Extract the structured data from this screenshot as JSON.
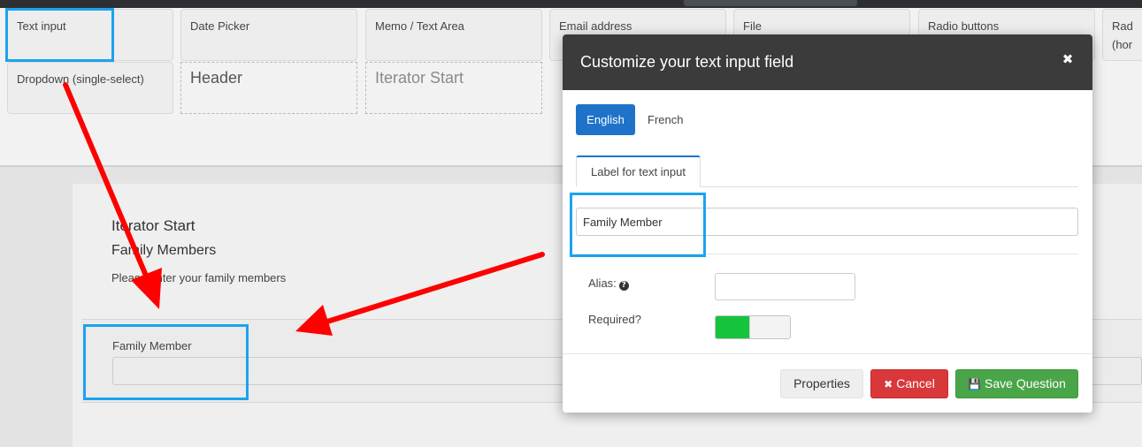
{
  "palette": {
    "tiles": [
      {
        "label": "Text input"
      },
      {
        "label": "Date Picker"
      },
      {
        "label": "Memo / Text Area"
      },
      {
        "label": "Email address"
      },
      {
        "label": "File"
      },
      {
        "label": "Radio buttons"
      },
      {
        "label": "Rad (hor"
      },
      {
        "label": "Dropdown (single-select)"
      },
      {
        "label": "Header"
      },
      {
        "label": "Iterator Start"
      }
    ]
  },
  "canvas": {
    "title": "Iterator Start",
    "subtitle": "Family Members",
    "description": "Please enter your family members",
    "field_label": "Family Member"
  },
  "modal": {
    "title": "Customize your text input field",
    "close_glyph": "✖",
    "languages": [
      {
        "label": "English",
        "active": true
      },
      {
        "label": "French",
        "active": false
      }
    ],
    "tab_label": "Label for text input",
    "label_value": "Family Member",
    "alias_label": "Alias:",
    "help_glyph": "?",
    "alias_value": "",
    "required_label": "Required?",
    "required_on": true,
    "buttons": {
      "properties": "Properties",
      "cancel": "Cancel",
      "cancel_icon": "✖",
      "save": "Save Question",
      "save_icon": "💾"
    }
  },
  "colors": {
    "primary": "#1e73c9",
    "danger": "#d9383a",
    "success": "#4aa548",
    "toggle_on": "#16c33d",
    "highlight": "#1aa3f0",
    "arrow": "#ff0000",
    "modal_header": "#3b3b3b"
  }
}
